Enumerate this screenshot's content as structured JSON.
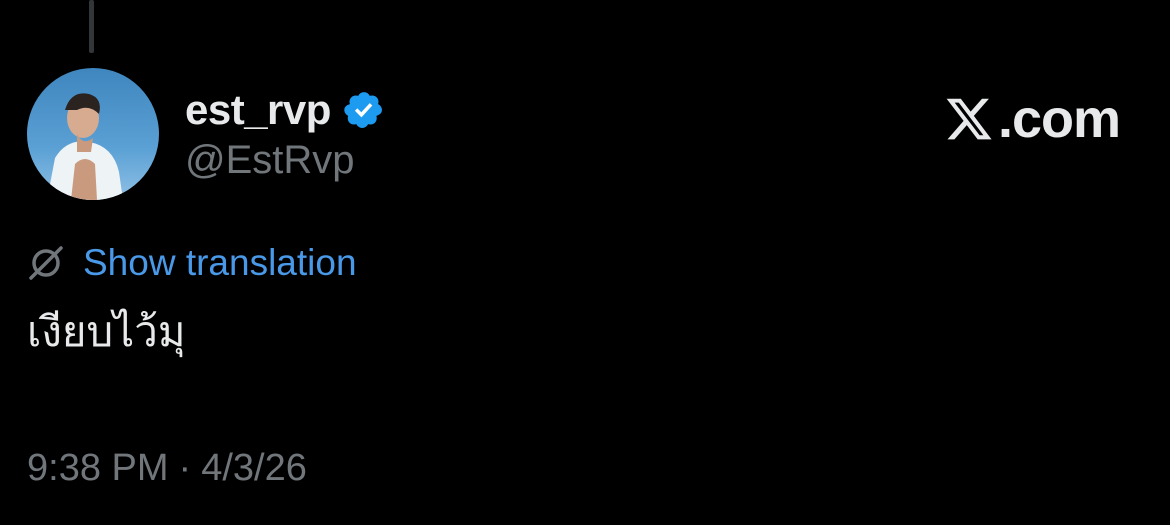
{
  "tweet": {
    "display_name": "est_rvp",
    "handle": "@EstRvp",
    "verified": true,
    "translation_label": "Show translation",
    "text": "เงียบไว้มุ",
    "time": "9:38 PM",
    "separator": "·",
    "date": "4/3/26"
  },
  "brand": {
    "text": ".com"
  },
  "colors": {
    "background": "#000000",
    "primary_text": "#e7e9ea",
    "secondary_text": "#71767b",
    "link": "#4a99e9",
    "verified": "#1d9bf0"
  },
  "icons": {
    "verified": "verified-badge-icon",
    "translation": "globe-icon",
    "brand": "x-logo-icon"
  }
}
